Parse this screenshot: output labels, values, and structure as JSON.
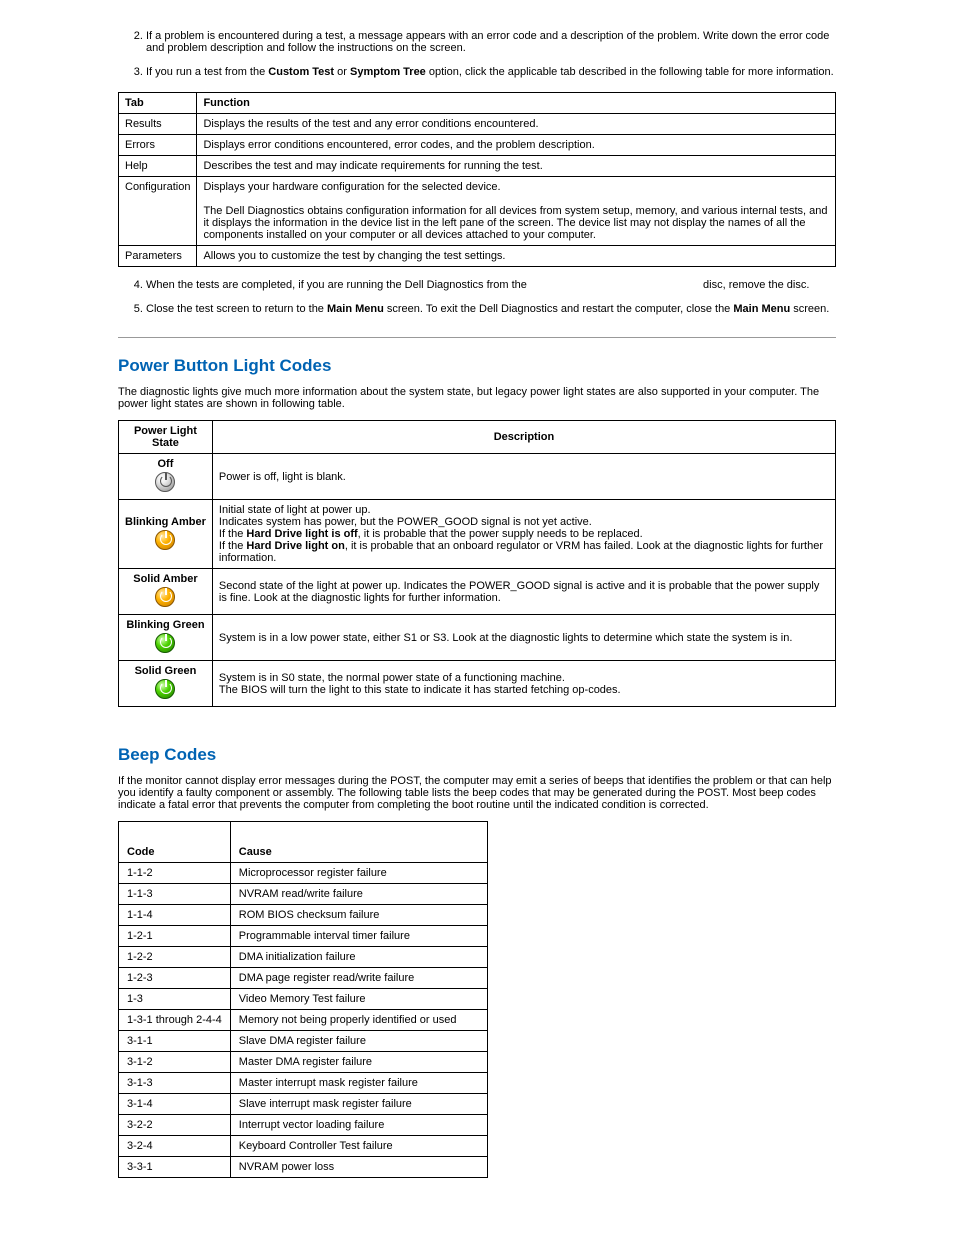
{
  "list1": {
    "item2": "If a problem is encountered during a test, a message appears with an error code and a description of the problem. Write down the error code and problem description and follow the instructions on the screen.",
    "item3_pre": "If you run a test from the ",
    "item3_b1": "Custom Test",
    "item3_mid": " or ",
    "item3_b2": "Symptom Tree",
    "item3_post": " option, click the applicable tab described in the following table for more information."
  },
  "tabtable": {
    "h1": "Tab",
    "h2": "Function",
    "rows": [
      {
        "tab": "Results",
        "func": "Displays the results of the test and any error conditions encountered."
      },
      {
        "tab": "Errors",
        "func": "Displays error conditions encountered, error codes, and the problem description."
      },
      {
        "tab": "Help",
        "func": "Describes the test and may indicate requirements for running the test."
      },
      {
        "tab": "Configuration",
        "func": "Displays your hardware configuration for the selected device.",
        "extra": "The Dell Diagnostics obtains configuration information for all devices from system setup, memory, and various internal tests, and it displays the information in the device list in the left pane of the screen. The device list may not display the names of all the components installed on your computer or all devices attached to your computer."
      },
      {
        "tab": "Parameters",
        "func": "Allows you to customize the test by changing the test settings."
      }
    ]
  },
  "list2": {
    "item4_pre": "When the tests are completed, if you are running the Dell Diagnostics from the ",
    "item4_post": " disc, remove the disc.",
    "item5_pre": "Close the test screen to return to the ",
    "item5_b1": "Main Menu",
    "item5_mid": " screen. To exit the Dell Diagnostics and restart the computer, close the ",
    "item5_b2": "Main Menu",
    "item5_post": " screen."
  },
  "section_power": {
    "heading": "Power Button Light Codes",
    "intro": "The diagnostic lights give much more information about the system state, but legacy power light states are also supported in your computer. The power light states are shown in following table.",
    "h1": "Power Light State",
    "h2": "Description",
    "r_off_label": "Off",
    "r_off_desc": "Power is off, light is blank.",
    "r_ba_label": "Blinking Amber",
    "r_ba_l1": "Initial state of light at power up.",
    "r_ba_l2": "Indicates system has power, but the POWER_GOOD signal is not yet active.",
    "r_ba_l3a": "If the ",
    "r_ba_l3b": "Hard Drive light is off",
    "r_ba_l3c": ", it is probable that the power supply needs to be replaced.",
    "r_ba_l4a": "If the ",
    "r_ba_l4b": "Hard Drive light on",
    "r_ba_l4c": ", it is probable that an onboard regulator or VRM has failed. Look at the diagnostic lights for further information.",
    "r_sa_label": "Solid Amber",
    "r_sa_desc": "Second state of the light at power up. Indicates the POWER_GOOD signal is active and it is probable that the power supply is fine. Look at the diagnostic lights for further information.",
    "r_bg_label": "Blinking Green",
    "r_bg_desc": "System is in a low power state, either S1 or S3. Look at the diagnostic lights to determine which state the system is in.",
    "r_sg_label": "Solid Green",
    "r_sg_l1": "System is in S0 state, the normal power state of a functioning machine.",
    "r_sg_l2": "The BIOS will turn the light to this state to indicate it has started fetching op-codes."
  },
  "section_beep": {
    "heading": "Beep Codes",
    "intro": "If the monitor cannot display error messages during the POST, the computer may emit a series of beeps that identifies the problem or that can help you identify a faulty component or assembly. The following table lists the beep codes that may be generated during the POST. Most beep codes indicate a fatal error that prevents the computer from completing the boot routine until the indicated condition is corrected.",
    "h1": "Code",
    "h2": "Cause",
    "rows": [
      {
        "code": "1-1-2",
        "cause": "Microprocessor register failure"
      },
      {
        "code": "1-1-3",
        "cause": "NVRAM read/write failure"
      },
      {
        "code": "1-1-4",
        "cause": "ROM BIOS checksum failure"
      },
      {
        "code": "1-2-1",
        "cause": "Programmable interval timer failure"
      },
      {
        "code": "1-2-2",
        "cause": "DMA initialization failure"
      },
      {
        "code": "1-2-3",
        "cause": "DMA page register read/write failure"
      },
      {
        "code": "1-3",
        "cause": "Video Memory Test failure"
      },
      {
        "code": "1-3-1 through 2-4-4",
        "cause": "Memory not being properly identified or used"
      },
      {
        "code": "3-1-1",
        "cause": "Slave DMA register failure"
      },
      {
        "code": "3-1-2",
        "cause": "Master DMA register failure"
      },
      {
        "code": "3-1-3",
        "cause": "Master interrupt mask register failure"
      },
      {
        "code": "3-1-4",
        "cause": "Slave interrupt mask register failure"
      },
      {
        "code": "3-2-2",
        "cause": "Interrupt vector loading failure"
      },
      {
        "code": "3-2-4",
        "cause": "Keyboard Controller Test failure"
      },
      {
        "code": "3-3-1",
        "cause": "NVRAM power loss"
      }
    ]
  }
}
